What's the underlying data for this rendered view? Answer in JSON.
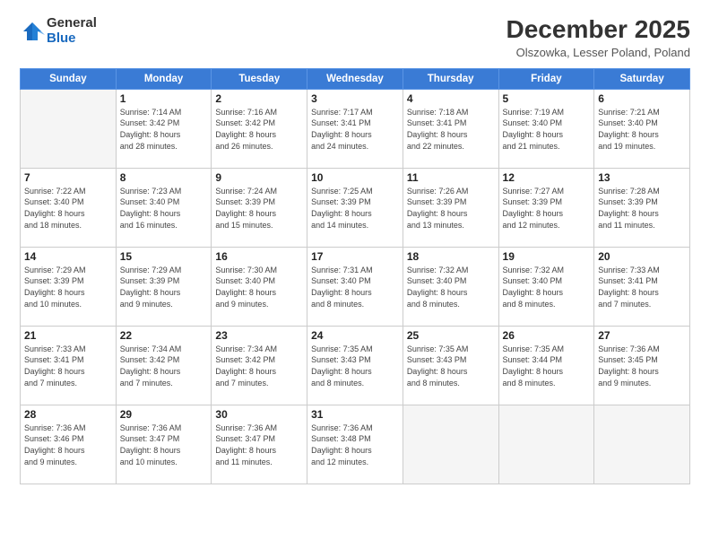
{
  "logo": {
    "general": "General",
    "blue": "Blue"
  },
  "title": "December 2025",
  "location": "Olszowka, Lesser Poland, Poland",
  "days_of_week": [
    "Sunday",
    "Monday",
    "Tuesday",
    "Wednesday",
    "Thursday",
    "Friday",
    "Saturday"
  ],
  "weeks": [
    [
      {
        "day": "",
        "info": ""
      },
      {
        "day": "1",
        "info": "Sunrise: 7:14 AM\nSunset: 3:42 PM\nDaylight: 8 hours\nand 28 minutes."
      },
      {
        "day": "2",
        "info": "Sunrise: 7:16 AM\nSunset: 3:42 PM\nDaylight: 8 hours\nand 26 minutes."
      },
      {
        "day": "3",
        "info": "Sunrise: 7:17 AM\nSunset: 3:41 PM\nDaylight: 8 hours\nand 24 minutes."
      },
      {
        "day": "4",
        "info": "Sunrise: 7:18 AM\nSunset: 3:41 PM\nDaylight: 8 hours\nand 22 minutes."
      },
      {
        "day": "5",
        "info": "Sunrise: 7:19 AM\nSunset: 3:40 PM\nDaylight: 8 hours\nand 21 minutes."
      },
      {
        "day": "6",
        "info": "Sunrise: 7:21 AM\nSunset: 3:40 PM\nDaylight: 8 hours\nand 19 minutes."
      }
    ],
    [
      {
        "day": "7",
        "info": "Sunrise: 7:22 AM\nSunset: 3:40 PM\nDaylight: 8 hours\nand 18 minutes."
      },
      {
        "day": "8",
        "info": "Sunrise: 7:23 AM\nSunset: 3:40 PM\nDaylight: 8 hours\nand 16 minutes."
      },
      {
        "day": "9",
        "info": "Sunrise: 7:24 AM\nSunset: 3:39 PM\nDaylight: 8 hours\nand 15 minutes."
      },
      {
        "day": "10",
        "info": "Sunrise: 7:25 AM\nSunset: 3:39 PM\nDaylight: 8 hours\nand 14 minutes."
      },
      {
        "day": "11",
        "info": "Sunrise: 7:26 AM\nSunset: 3:39 PM\nDaylight: 8 hours\nand 13 minutes."
      },
      {
        "day": "12",
        "info": "Sunrise: 7:27 AM\nSunset: 3:39 PM\nDaylight: 8 hours\nand 12 minutes."
      },
      {
        "day": "13",
        "info": "Sunrise: 7:28 AM\nSunset: 3:39 PM\nDaylight: 8 hours\nand 11 minutes."
      }
    ],
    [
      {
        "day": "14",
        "info": "Sunrise: 7:29 AM\nSunset: 3:39 PM\nDaylight: 8 hours\nand 10 minutes."
      },
      {
        "day": "15",
        "info": "Sunrise: 7:29 AM\nSunset: 3:39 PM\nDaylight: 8 hours\nand 9 minutes."
      },
      {
        "day": "16",
        "info": "Sunrise: 7:30 AM\nSunset: 3:40 PM\nDaylight: 8 hours\nand 9 minutes."
      },
      {
        "day": "17",
        "info": "Sunrise: 7:31 AM\nSunset: 3:40 PM\nDaylight: 8 hours\nand 8 minutes."
      },
      {
        "day": "18",
        "info": "Sunrise: 7:32 AM\nSunset: 3:40 PM\nDaylight: 8 hours\nand 8 minutes."
      },
      {
        "day": "19",
        "info": "Sunrise: 7:32 AM\nSunset: 3:40 PM\nDaylight: 8 hours\nand 8 minutes."
      },
      {
        "day": "20",
        "info": "Sunrise: 7:33 AM\nSunset: 3:41 PM\nDaylight: 8 hours\nand 7 minutes."
      }
    ],
    [
      {
        "day": "21",
        "info": "Sunrise: 7:33 AM\nSunset: 3:41 PM\nDaylight: 8 hours\nand 7 minutes."
      },
      {
        "day": "22",
        "info": "Sunrise: 7:34 AM\nSunset: 3:42 PM\nDaylight: 8 hours\nand 7 minutes."
      },
      {
        "day": "23",
        "info": "Sunrise: 7:34 AM\nSunset: 3:42 PM\nDaylight: 8 hours\nand 7 minutes."
      },
      {
        "day": "24",
        "info": "Sunrise: 7:35 AM\nSunset: 3:43 PM\nDaylight: 8 hours\nand 8 minutes."
      },
      {
        "day": "25",
        "info": "Sunrise: 7:35 AM\nSunset: 3:43 PM\nDaylight: 8 hours\nand 8 minutes."
      },
      {
        "day": "26",
        "info": "Sunrise: 7:35 AM\nSunset: 3:44 PM\nDaylight: 8 hours\nand 8 minutes."
      },
      {
        "day": "27",
        "info": "Sunrise: 7:36 AM\nSunset: 3:45 PM\nDaylight: 8 hours\nand 9 minutes."
      }
    ],
    [
      {
        "day": "28",
        "info": "Sunrise: 7:36 AM\nSunset: 3:46 PM\nDaylight: 8 hours\nand 9 minutes."
      },
      {
        "day": "29",
        "info": "Sunrise: 7:36 AM\nSunset: 3:47 PM\nDaylight: 8 hours\nand 10 minutes."
      },
      {
        "day": "30",
        "info": "Sunrise: 7:36 AM\nSunset: 3:47 PM\nDaylight: 8 hours\nand 11 minutes."
      },
      {
        "day": "31",
        "info": "Sunrise: 7:36 AM\nSunset: 3:48 PM\nDaylight: 8 hours\nand 12 minutes."
      },
      {
        "day": "",
        "info": ""
      },
      {
        "day": "",
        "info": ""
      },
      {
        "day": "",
        "info": ""
      }
    ]
  ]
}
